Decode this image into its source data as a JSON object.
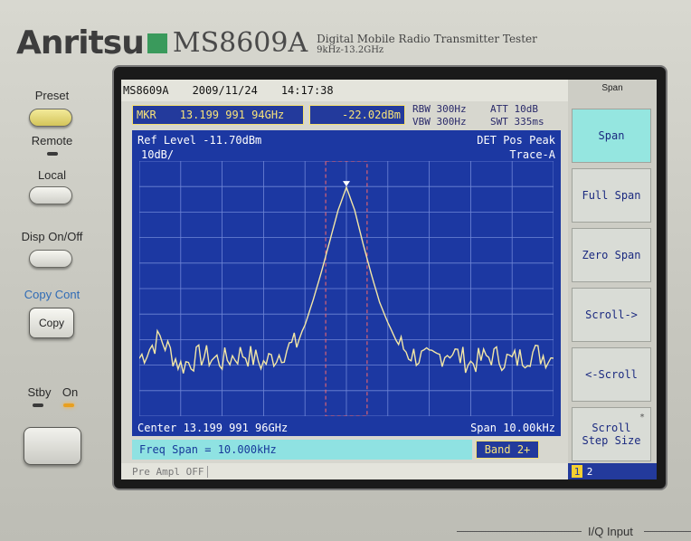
{
  "brand": {
    "logo": "Anritsu",
    "model": "MS8609A",
    "description": "Digital Mobile Radio Transmitter Tester",
    "freq_range": "9kHz-13.2GHz",
    "accent": "#3a9a5c"
  },
  "front_panel": {
    "preset_label": "Preset",
    "remote_label": "Remote",
    "local_label": "Local",
    "disp_label": "Disp  On/Off",
    "copy_cont_label": "Copy  Cont",
    "copy_button": "Copy",
    "stby_label": "Stby",
    "on_label": "On",
    "iq_label": "I/Q  Input"
  },
  "screen": {
    "topbar": {
      "model": "MS8609A",
      "date": "2009/11/24",
      "time": "14:17:38"
    },
    "marker": {
      "label": "MKR",
      "frequency": "13.199 991 94GHz",
      "level": "-22.02dBm"
    },
    "params": {
      "rbw": "RBW 300Hz",
      "att": "ATT  10dB",
      "vbw": "VBW 300Hz",
      "swt": "SWT  335ms"
    },
    "plot": {
      "ref_level": "Ref Level -11.70dBm",
      "scale": "10dB/",
      "det": "DET  Pos Peak",
      "trace": "Trace-A",
      "center": "Center 13.199 991 96GHz",
      "span": "Span 10.00kHz"
    },
    "freq_span_entry": "Freq Span = 10.000kHz",
    "band": "Band 2+",
    "status": "Pre Ampl OFF",
    "softkeys": {
      "title": "Span",
      "items": [
        {
          "label": "Span",
          "active": true
        },
        {
          "label": "Full Span",
          "active": false
        },
        {
          "label": "Zero Span",
          "active": false
        },
        {
          "label": "Scroll->",
          "active": false
        },
        {
          "label": "<-Scroll",
          "active": false
        },
        {
          "label1": "Scroll",
          "label2": "Step Size",
          "mark": "*",
          "active": false
        }
      ],
      "pages": [
        "1",
        "2"
      ],
      "current_page": "1"
    }
  },
  "chart_data": {
    "type": "line",
    "title": "",
    "xlabel": "",
    "ylabel": "",
    "center_frequency": "13.199 991 96GHz",
    "span": "10.00kHz",
    "ref_level_dbm": -11.7,
    "db_per_div": 10,
    "xlim": [
      -5,
      5
    ],
    "x_unit": "kHz offset from center",
    "ylim": [
      -111.7,
      -11.7
    ],
    "grid": true,
    "series": [
      {
        "name": "Trace-A",
        "x": [
          -5.0,
          -4.5,
          -4.0,
          -3.5,
          -3.0,
          -2.5,
          -2.0,
          -1.5,
          -1.2,
          -1.0,
          -0.8,
          -0.6,
          -0.4,
          -0.2,
          0.0,
          0.2,
          0.4,
          0.6,
          0.8,
          1.0,
          1.2,
          1.5,
          2.0,
          2.5,
          3.0,
          3.5,
          4.0,
          4.5,
          5.0
        ],
        "y": [
          -89,
          -81,
          -92,
          -88,
          -90,
          -87,
          -91,
          -86,
          -83,
          -76,
          -66,
          -55,
          -43,
          -31,
          -22,
          -31,
          -44,
          -56,
          -67,
          -75,
          -82,
          -87,
          -90,
          -86,
          -91,
          -88,
          -90,
          -87,
          -89
        ]
      }
    ],
    "marker": {
      "x": 0.0,
      "y": -22.02
    }
  }
}
